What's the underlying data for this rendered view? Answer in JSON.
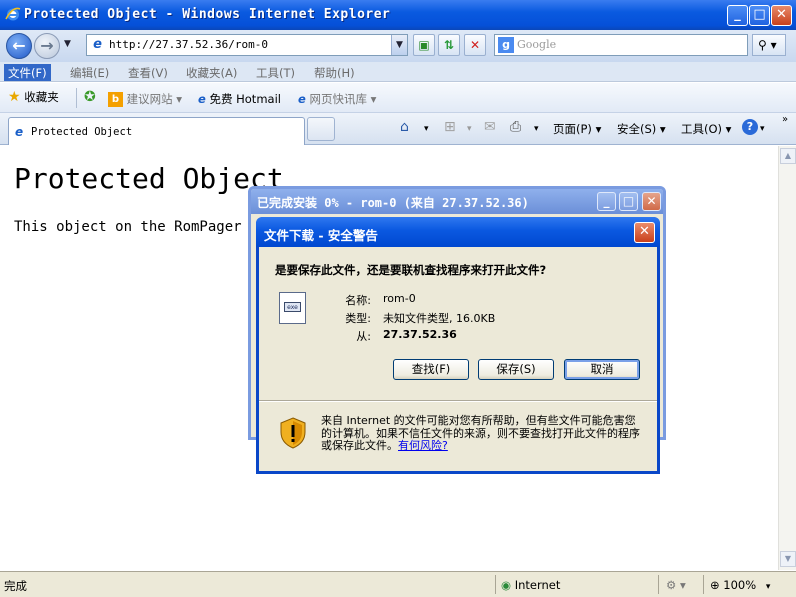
{
  "window": {
    "title": "Protected Object - Windows Internet Explorer"
  },
  "address_bar": {
    "url": "http://27.37.52.36/rom-0",
    "search_placeholder": "Google"
  },
  "menu": {
    "items": [
      "文件(F)",
      "编辑(E)",
      "查看(V)",
      "收藏夹(A)",
      "工具(T)",
      "帮助(H)"
    ]
  },
  "favorites_bar": {
    "favorites_label": "收藏夹",
    "items": [
      "建议网站 ▾",
      "免费 Hotmail",
      "网页快讯库 ▾"
    ]
  },
  "tabs": {
    "active_label": "Protected Object"
  },
  "command_bar": {
    "page": "页面(P) ▾",
    "safety": "安全(S) ▾",
    "tools": "工具(O) ▾"
  },
  "page": {
    "heading": "Protected Object",
    "body": "This object on the RomPager se"
  },
  "status_bar": {
    "status": "完成",
    "zone": "Internet",
    "zoom": "100%"
  },
  "progress_dialog": {
    "title": "已完成安装 0% - rom-0 (来自 27.37.52.36)"
  },
  "download_dialog": {
    "title": "文件下载 - 安全警告",
    "question": "是要保存此文件，还是要联机查找程序来打开此文件?",
    "name_label": "名称:",
    "name_value": "rom-0",
    "type_label": "类型:",
    "type_value": "未知文件类型, 16.0KB",
    "from_label": "从:",
    "from_value": "27.37.52.36",
    "find_button": "查找(F)",
    "save_button": "保存(S)",
    "cancel_button": "取消",
    "warning_text": "来自 Internet 的文件可能对您有所帮助，但有些文件可能危害您的计算机。如果不信任文件的来源，则不要查找打开此文件的程序或保存此文件。",
    "risk_link": "有何风险?"
  },
  "icons": [
    "ie-logo",
    "back-arrow",
    "forward-arrow",
    "refresh",
    "stop",
    "search",
    "favorites-star",
    "home",
    "rss",
    "mail",
    "print",
    "help",
    "globe",
    "zoom",
    "file",
    "security-shield"
  ]
}
